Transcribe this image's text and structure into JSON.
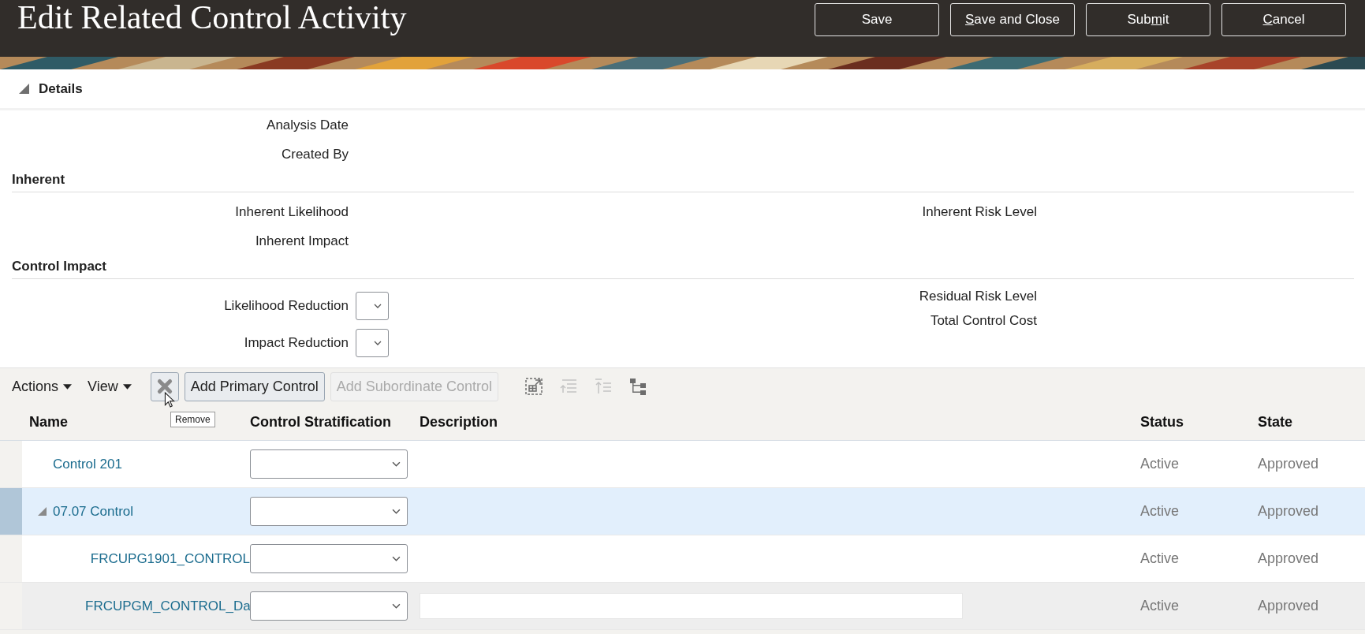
{
  "header": {
    "title": "Edit Related Control Activity",
    "buttons": [
      {
        "segments": [
          {
            "text": "Save",
            "underlined": false
          }
        ]
      },
      {
        "segments": [
          {
            "text": "S",
            "underlined": true
          },
          {
            "text": "ave and Close",
            "underlined": false
          }
        ]
      },
      {
        "segments": [
          {
            "text": "Sub",
            "underlined": false
          },
          {
            "text": "m",
            "underlined": true
          },
          {
            "text": "it",
            "underlined": false
          }
        ]
      },
      {
        "segments": [
          {
            "text": "C",
            "underlined": true
          },
          {
            "text": "ancel",
            "underlined": false
          }
        ]
      }
    ]
  },
  "details": {
    "title": "Details",
    "expanded": true,
    "fields": [
      "Analysis Date",
      "Created By"
    ],
    "inherent": {
      "title": "Inherent",
      "left": [
        "Inherent Likelihood",
        "Inherent Impact"
      ],
      "right": [
        "Inherent Risk Level"
      ]
    },
    "control_impact": {
      "title": "Control Impact",
      "left": [
        "Likelihood Reduction",
        "Impact Reduction"
      ],
      "right": [
        "Residual Risk Level",
        "Total Control Cost"
      ]
    }
  },
  "toolbar": {
    "menus": [
      "Actions",
      "View"
    ],
    "buttons": [
      {
        "kind": "remove",
        "disabled": false
      },
      {
        "kind": "text",
        "label": "Add Primary Control",
        "disabled": false
      },
      {
        "kind": "text",
        "label": "Add Subordinate Control",
        "disabled": true
      }
    ],
    "icons": [
      {
        "kind": "frame",
        "disabled": false
      },
      {
        "kind": "indent",
        "disabled": true
      },
      {
        "kind": "outdent",
        "disabled": true
      },
      {
        "kind": "hierarchy",
        "disabled": false
      }
    ],
    "tooltip": "Remove"
  },
  "table": {
    "columns": [
      "Name",
      "Control Stratification",
      "Description",
      "Status",
      "State"
    ],
    "rows": [
      {
        "name": "Control 201",
        "description_field": false,
        "status": "Active",
        "state": "Approved",
        "selected": false,
        "hovered": false
      },
      {
        "name": "07.07 Control",
        "description_field": false,
        "status": "Active",
        "state": "Approved",
        "selected": true,
        "hovered": false,
        "expanded": true,
        "children": [
          {
            "name": "FRCUPG1901_CONTROL",
            "description_field": false,
            "status": "Active",
            "state": "Approved",
            "selected": false,
            "hovered": false
          },
          {
            "name": "FRCUPGM_CONTROL_Da",
            "description_field": true,
            "status": "Active",
            "state": "Approved",
            "selected": false,
            "hovered": true
          }
        ]
      }
    ]
  }
}
